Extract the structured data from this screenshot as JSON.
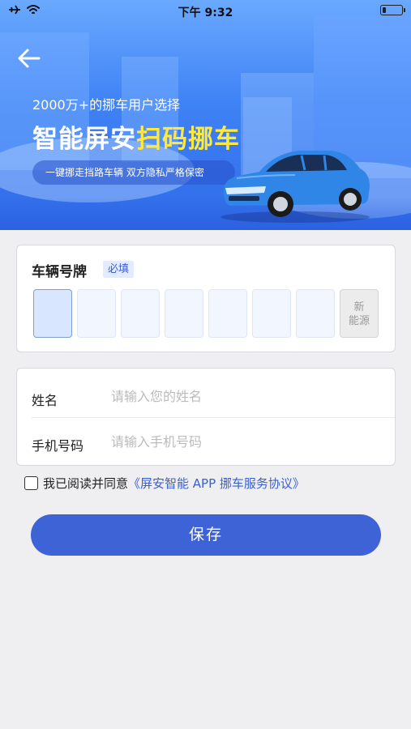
{
  "status_bar": {
    "time": "下午 9:32"
  },
  "banner": {
    "subtitle": "2000万+的挪车用户选择",
    "headline_part1": "智能屏安",
    "headline_part2": "扫码挪车",
    "tagline": "一键挪走挡路车辆  双方隐私严格保密"
  },
  "plate": {
    "title": "车辆号牌",
    "required": "必填",
    "new_energy_line1": "新",
    "new_energy_line2": "能源"
  },
  "form": {
    "name_label": "姓名",
    "name_placeholder": "请输入您的姓名",
    "phone_label": "手机号码",
    "phone_placeholder": "请输入手机号码"
  },
  "agreement": {
    "text": "我已阅读并同意",
    "link": "《屏安智能 APP 挪车服务协议》"
  },
  "save_button": "保存",
  "colors": {
    "primary": "#3e63d6",
    "highlight": "#ffe93b",
    "banner_blue": "#3f82f5"
  }
}
